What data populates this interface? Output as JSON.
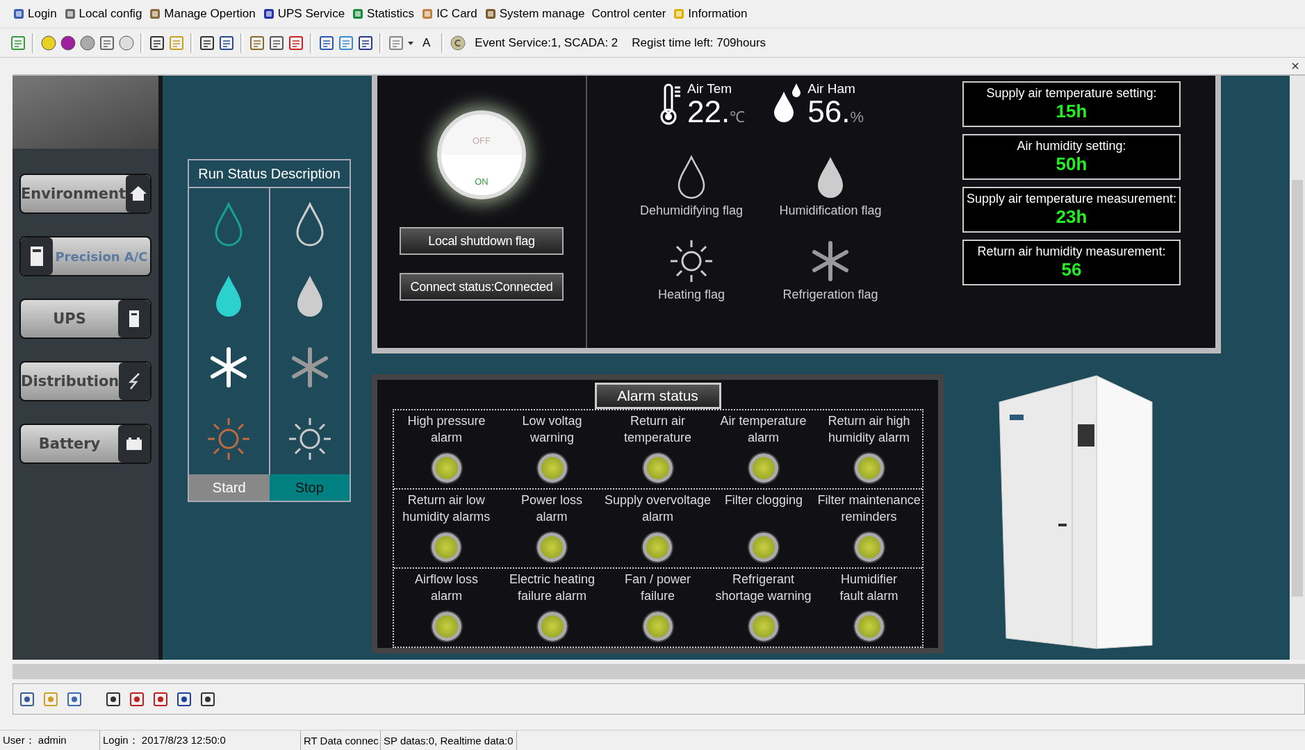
{
  "menu": [
    "Login",
    "Local config",
    "Manage Opertion",
    "UPS Service",
    "Statistics",
    "IC Card",
    "System manage",
    "Control center",
    "Information"
  ],
  "toolbar": {
    "font_button": "A",
    "event_service": "Event Service:1, SCADA: 2",
    "regist_time": "Regist time left: 709hours"
  },
  "nav": [
    {
      "label": "Environment",
      "selected": false
    },
    {
      "label": "Precision A/C",
      "selected": true
    },
    {
      "label": "UPS",
      "selected": false
    },
    {
      "label": "Distribution",
      "selected": false
    },
    {
      "label": "Battery",
      "selected": false
    }
  ],
  "run_status": {
    "title": "Run Status Description",
    "columns": [
      "Stard",
      "Stop"
    ]
  },
  "power_switch": {
    "off_label": "OFF",
    "on_label": "ON",
    "on": true
  },
  "status_buttons": [
    "Local shutdown flag",
    "Connect status:Connected"
  ],
  "readings": [
    {
      "kind": "temperature",
      "label": "Air Tem",
      "value": "22.",
      "unit": "℃"
    },
    {
      "kind": "humidity",
      "label": "Air Ham",
      "value": "56.",
      "unit": "%"
    }
  ],
  "flags": [
    {
      "kind": "drop-outline",
      "label": "Dehumidifying flag"
    },
    {
      "kind": "drop-filled",
      "label": "Humidification flag"
    },
    {
      "kind": "sun",
      "label": "Heating flag"
    },
    {
      "kind": "snowflake",
      "label": "Refrigeration flag"
    }
  ],
  "settings": [
    {
      "label": "Supply air temperature setting:",
      "value": "15h"
    },
    {
      "label": "Air humidity setting:",
      "value": "50h"
    },
    {
      "label": "Supply air temperature measurement:",
      "value": "23h"
    },
    {
      "label": "Return air humidity measurement:",
      "value": "56"
    }
  ],
  "alarm_status": {
    "title": "Alarm status",
    "alarms": [
      [
        "High pressure",
        "alarm"
      ],
      [
        "Low voltag",
        "warning"
      ],
      [
        "Return air",
        "temperature"
      ],
      [
        "Air temperature",
        "alarm"
      ],
      [
        "Return air high",
        "humidity alarm"
      ],
      [
        "Return air low",
        "humidity alarms"
      ],
      [
        "Power loss",
        "alarm"
      ],
      [
        "Supply overvoltage",
        "alarm"
      ],
      [
        "Filter clogging"
      ],
      [
        "Filter maintenance",
        "reminders"
      ],
      [
        "Airflow loss",
        "alarm"
      ],
      [
        "Electric heating",
        "failure alarm"
      ],
      [
        "Fan / power",
        "failure"
      ],
      [
        "Refrigerant",
        "shortage warning"
      ],
      [
        "Humidifier",
        "fault alarm"
      ]
    ]
  },
  "status_bar": [
    "User： admin",
    "Login： 2017/8/23 12:50:0",
    "RT Data connec",
    "SP datas:0, Realtime data:0"
  ]
}
